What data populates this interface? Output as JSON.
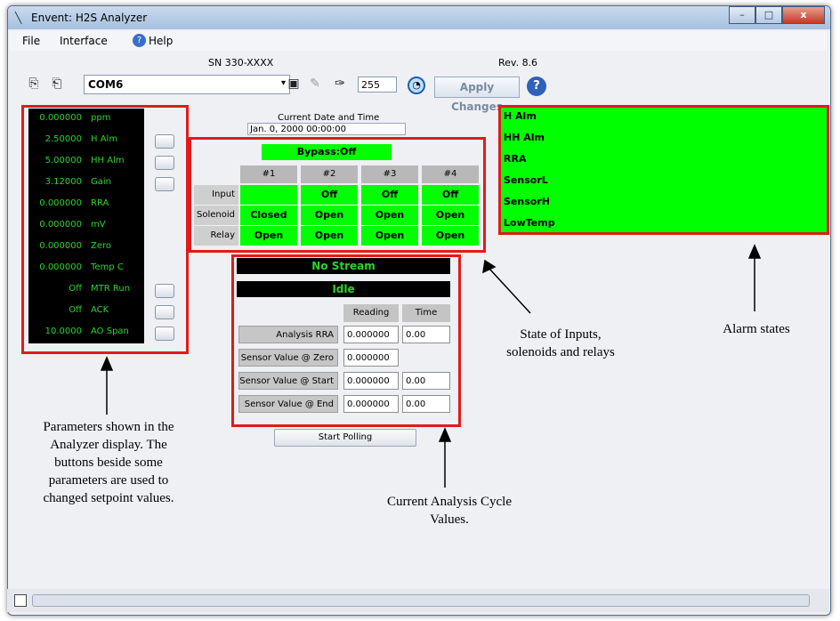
{
  "window": {
    "title": "Envent: H2S Analyzer",
    "minimize_label": "–",
    "maximize_label": "□",
    "close_label": "x"
  },
  "menu": {
    "file": "File",
    "interface": "Interface",
    "help": "Help"
  },
  "info": {
    "sn": "SN 330-XXXX",
    "rev": "Rev. 8.6"
  },
  "toolbar": {
    "com_port": "COM6",
    "number": "255",
    "apply_label": "Apply Changes",
    "help_symbol": "?"
  },
  "params": [
    {
      "value": "0.000000",
      "name": "ppm",
      "has_button": false
    },
    {
      "value": "2.50000",
      "name": "H Alm",
      "has_button": true
    },
    {
      "value": "5.00000",
      "name": "HH Alm",
      "has_button": true
    },
    {
      "value": "3.12000",
      "name": "Gain",
      "has_button": true
    },
    {
      "value": "0.000000",
      "name": "RRA",
      "has_button": false
    },
    {
      "value": "0.000000",
      "name": "mV",
      "has_button": false
    },
    {
      "value": "0.000000",
      "name": "Zero",
      "has_button": false
    },
    {
      "value": "0.000000",
      "name": "Temp C",
      "has_button": false
    },
    {
      "value": "Off",
      "name": "MTR Run",
      "has_button": true
    },
    {
      "value": "Off",
      "name": "ACK",
      "has_button": true
    },
    {
      "value": "10.0000",
      "name": "AO Span",
      "has_button": true
    }
  ],
  "datetime": {
    "label": "Current Date and Time",
    "value": "Jan. 0, 2000 00:00:00"
  },
  "io": {
    "bypass": "Bypass:Off",
    "columns": [
      "#1",
      "#2",
      "#3",
      "#4"
    ],
    "row_labels": [
      "Input",
      "Solenoid",
      "Relay"
    ],
    "rows": [
      [
        "",
        "Off",
        "Off",
        "Off"
      ],
      [
        "Closed",
        "Open",
        "Open",
        "Open"
      ],
      [
        "Open",
        "Open",
        "Open",
        "Open"
      ]
    ]
  },
  "cycle": {
    "stream": "No Stream",
    "state": "Idle",
    "col_reading": "Reading",
    "col_time": "Time",
    "rows": [
      {
        "label": "Analysis RRA",
        "reading": "0.000000",
        "time": "0.00"
      },
      {
        "label": "Sensor Value @ Zero",
        "reading": "0.000000",
        "time": null
      },
      {
        "label": "Sensor Value @ Start",
        "reading": "0.000000",
        "time": "0.00"
      },
      {
        "label": "Sensor Value @ End",
        "reading": "0.000000",
        "time": "0.00"
      }
    ],
    "start_polling": "Start Polling"
  },
  "alarms": [
    "H Alm",
    "HH Alm",
    "RRA",
    "SensorL",
    "SensorH",
    "LowTemp"
  ],
  "annotations": {
    "params_note": [
      "Parameters shown in the",
      "Analyzer display.  The",
      "buttons beside some",
      "parameters are used to",
      "changed setpoint values."
    ],
    "io_note": [
      "State of Inputs,",
      "solenoids  and relays"
    ],
    "alarm_note": "Alarm states",
    "cycle_note": [
      "Current Analysis Cycle",
      "Values."
    ]
  },
  "colors": {
    "status_green": "#00ff00",
    "highlight_red": "#e01b1b",
    "lcd_text": "#2bd42b"
  }
}
